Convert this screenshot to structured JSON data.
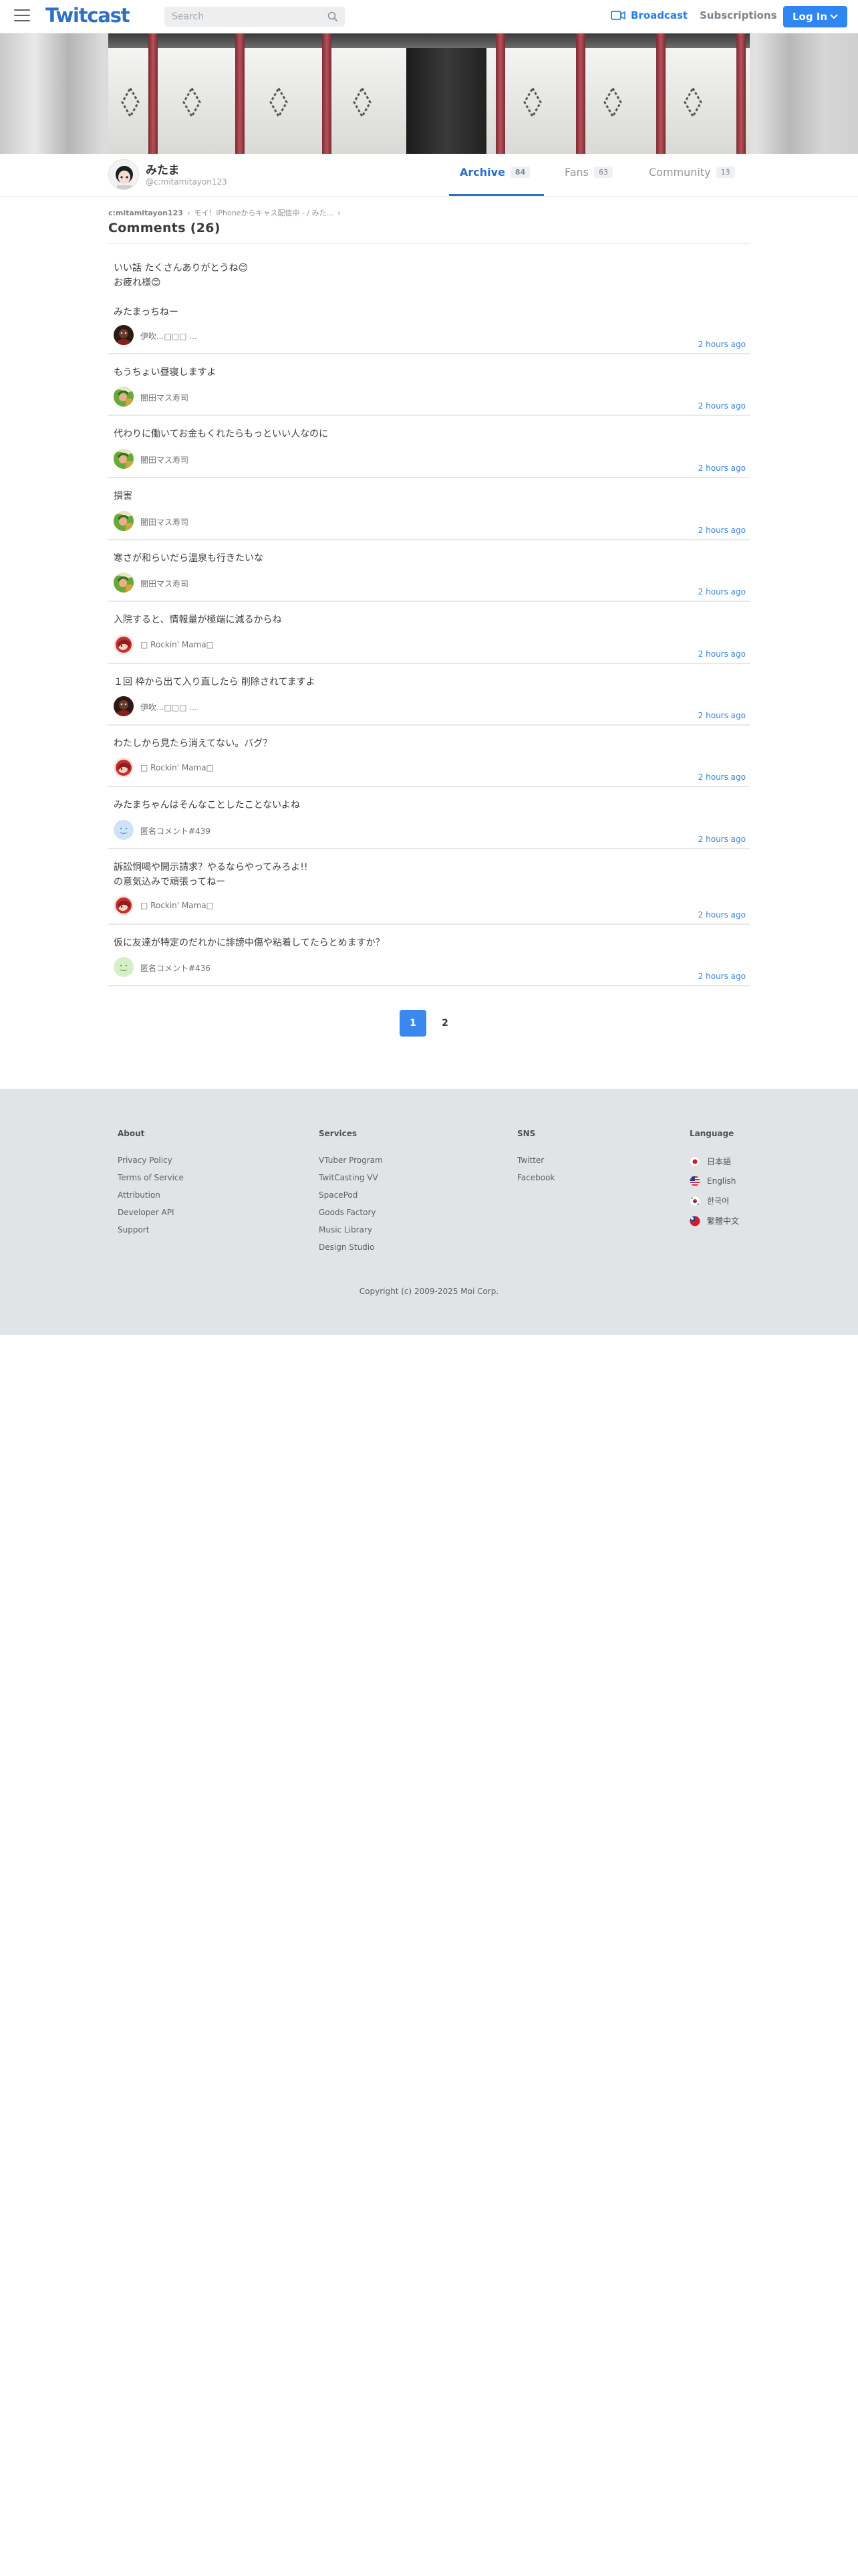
{
  "header": {
    "logo": "Twitcast",
    "search_placeholder": "Search",
    "broadcast_label": "Broadcast",
    "subscriptions_label": "Subscriptions",
    "login_label": "Log In"
  },
  "profile": {
    "name": "みたま",
    "handle": "@c:mitamitayon123",
    "tabs": [
      {
        "label": "Archive",
        "count": "84"
      },
      {
        "label": "Fans",
        "count": "63"
      },
      {
        "label": "Community",
        "count": "13"
      }
    ]
  },
  "breadcrumb": {
    "user": "c:mitamitayon123",
    "movie": "モイ！iPhoneからキャス配信中 - / みた..."
  },
  "comments_title": "Comments (26)",
  "comments": [
    {
      "text": "いい話 たくさんありがとうね😊\nお疲れ様😊\n\nみたまっちねー",
      "user": "伊吹...□□□ ...",
      "time": "2 hours ago",
      "avatar": "dark"
    },
    {
      "text": "もうちょい昼寝しますよ",
      "user": "闇田マス寿司",
      "time": "2 hours ago",
      "avatar": "green"
    },
    {
      "text": "代わりに働いてお金もくれたらもっといい人なのに",
      "user": "闇田マス寿司",
      "time": "2 hours ago",
      "avatar": "green"
    },
    {
      "text": "損害",
      "user": "闇田マス寿司",
      "time": "2 hours ago",
      "avatar": "green"
    },
    {
      "text": "寒さが和らいだら温泉も行きたいな",
      "user": "闇田マス寿司",
      "time": "2 hours ago",
      "avatar": "green"
    },
    {
      "text": "入院すると、情報量が極端に減るからね",
      "user": "□ Rockin' Mama□",
      "time": "2 hours ago",
      "avatar": "red"
    },
    {
      "text": "１回 枠から出て入り直したら 削除されてますよ",
      "user": "伊吹...□□□ ...",
      "time": "2 hours ago",
      "avatar": "dark"
    },
    {
      "text": "わたしから見たら消えてない。バグ？",
      "user": "□ Rockin' Mama□",
      "time": "2 hours ago",
      "avatar": "red"
    },
    {
      "text": "みたまちゃんはそんなことしたことないよね",
      "user": "匿名コメント#439",
      "time": "2 hours ago",
      "avatar": "blueface"
    },
    {
      "text": "訴訟恫喝や開示請求？やるならやってみろよ!!\nの意気込みで頑張ってねー",
      "user": "□ Rockin' Mama□",
      "time": "2 hours ago",
      "avatar": "red"
    },
    {
      "text": "仮に友達が特定のだれかに誹謗中傷や粘着してたらとめますか？",
      "user": "匿名コメント#436",
      "time": "2 hours ago",
      "avatar": "greenface"
    }
  ],
  "pagination": [
    "1",
    "2"
  ],
  "footer": {
    "about": {
      "title": "About",
      "links": [
        "Privacy Policy",
        "Terms of Service",
        "Attribution",
        "Developer API",
        "Support"
      ]
    },
    "services": {
      "title": "Services",
      "links": [
        "VTuber Program",
        "TwitCasting VV",
        "SpacePod",
        "Goods Factory",
        "Music Library",
        "Design Studio"
      ]
    },
    "sns": {
      "title": "SNS",
      "links": [
        "Twitter",
        "Facebook"
      ]
    },
    "language": {
      "title": "Language",
      "items": [
        "日本語",
        "English",
        "한국어",
        "繁體中文"
      ]
    },
    "copyright": "Copyright (c) 2009-2025 Moi Corp."
  },
  "colors": {
    "accent": "#2f86f0",
    "link": "#3a84d6",
    "brand": "#2f6fc4"
  }
}
